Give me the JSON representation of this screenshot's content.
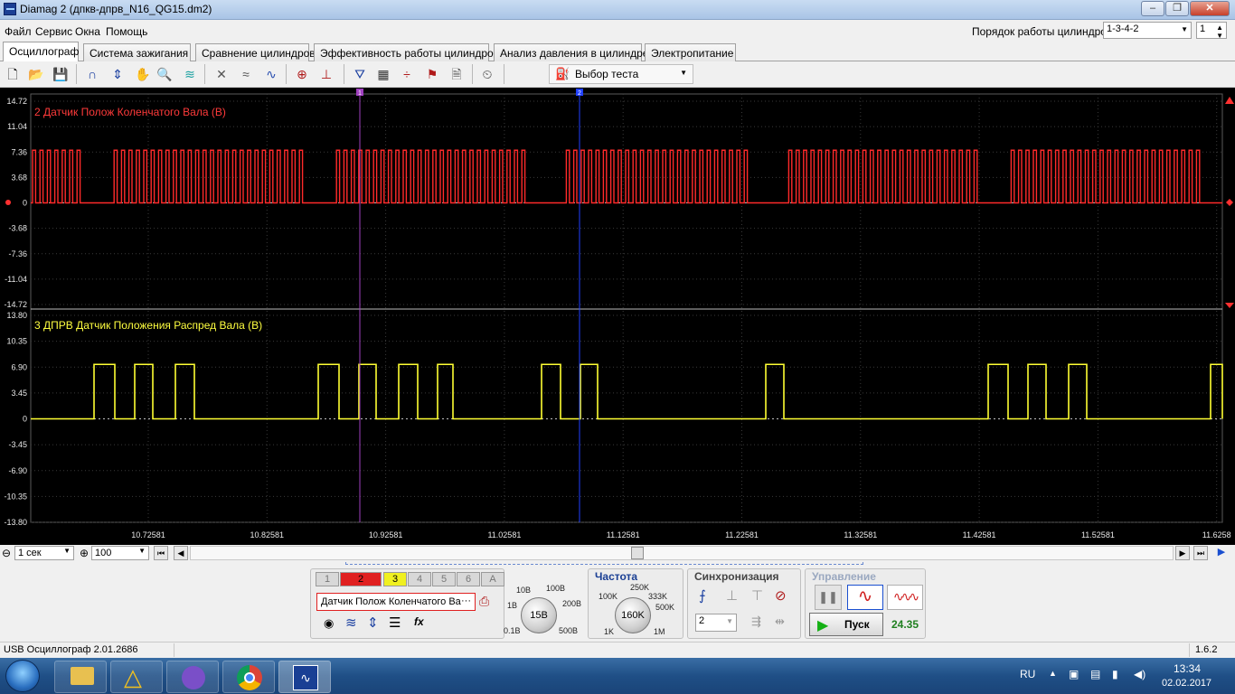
{
  "window": {
    "title": "Diamag 2 (дпкв-дпрв_N16_QG15.dm2)"
  },
  "menu": [
    "Файл",
    "Сервис",
    "Окна",
    "Помощь"
  ],
  "firing_order": {
    "label": "Порядок работы цилиндров",
    "value": "1-3-4-2",
    "cylinder": "1"
  },
  "tabs": [
    "Осциллограф",
    "Система зажигания",
    "Сравнение цилиндров",
    "Эффективность работы цилиндров",
    "Анализ давления в цилиндре",
    "Электропитание"
  ],
  "toolbar": {
    "test_select": "Выбор теста"
  },
  "scope": {
    "background": "#000000",
    "cursors": [
      "1",
      "2"
    ],
    "channel_top": {
      "label": "2 Датчик Полож Коленчатого Вала (В)",
      "color": "#ff2a2a",
      "y_ticks": [
        "14.72",
        "11.04",
        "7.36",
        "3.68",
        "0",
        "-3.68",
        "-7.36",
        "-11.04",
        "-14.72"
      ]
    },
    "channel_bottom": {
      "label": "3 ДПРВ Датчик Положения Распред Вала (В)",
      "color": "#ffff33",
      "y_ticks": [
        "13.80",
        "10.35",
        "6.90",
        "3.45",
        "0",
        "-3.45",
        "-6.90",
        "-10.35",
        "-13.80"
      ]
    },
    "x_ticks": [
      "10.72581",
      "10.82581",
      "10.92581",
      "11.02581",
      "11.12581",
      "11.22581",
      "11.32581",
      "11.42581",
      "11.52581",
      "11.6258"
    ]
  },
  "controls": {
    "timebase": "1 сек",
    "zoom": "100",
    "channels": [
      "1",
      "2",
      "3",
      "4",
      "5",
      "6",
      "A"
    ],
    "channel_name": "Датчик Полож Коленчатого Ва",
    "channel_name_more": "···",
    "range": {
      "value": "15B",
      "labels": [
        "10B",
        "100B",
        "1B",
        "200B",
        "0.1B",
        "500B"
      ]
    },
    "frequency": {
      "title": "Частота",
      "value": "160K",
      "labels": [
        "250K",
        "100K",
        "333K",
        "500K",
        "1K",
        "1M"
      ]
    },
    "sync": {
      "title": "Синхронизация",
      "channel": "2"
    },
    "control": {
      "title": "Управление",
      "start": "Пуск",
      "value": "24.35"
    }
  },
  "statusbar": {
    "left": "USB Осциллограф  2.01.2686",
    "right": "1.6.2"
  },
  "taskbar": {
    "lang": "RU",
    "time": "13:34",
    "date": "02.02.2017"
  }
}
